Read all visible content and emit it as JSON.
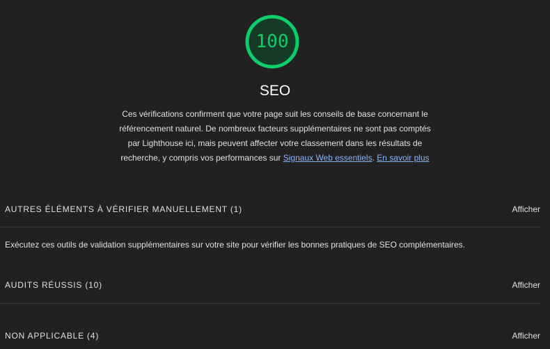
{
  "score": {
    "value": "100",
    "fraction": 1.0,
    "color": "#0cce6b",
    "ring_background": "#0b3f27"
  },
  "category": {
    "title": "SEO",
    "description": "Ces vérifications confirment que votre page suit les conseils de base concernant le référencement naturel. De nombreux facteurs supplémentaires ne sont pas comptés par Lighthouse ici, mais peuvent affecter votre classement dans les résultats de recherche, y compris vos performances sur ",
    "link_web_vitals": "Signaux Web essentiels",
    "separator": ". ",
    "link_learn_more": "En savoir plus"
  },
  "groups": [
    {
      "title": "AUTRES ÉLÉMENTS À VÉRIFIER MANUELLEMENT (1)",
      "toggle": "Afficher",
      "description": "Exécutez ces outils de validation supplémentaires sur votre site pour vérifier les bonnes pratiques de SEO complémentaires."
    },
    {
      "title": "AUDITS RÉUSSIS (10)",
      "toggle": "Afficher"
    },
    {
      "title": "NON APPLICABLE (4)",
      "toggle": "Afficher"
    }
  ],
  "colors": {
    "background": "#212121",
    "text": "#e0e0e0",
    "link": "#8ab4f8",
    "pass": "#0cce6b"
  }
}
